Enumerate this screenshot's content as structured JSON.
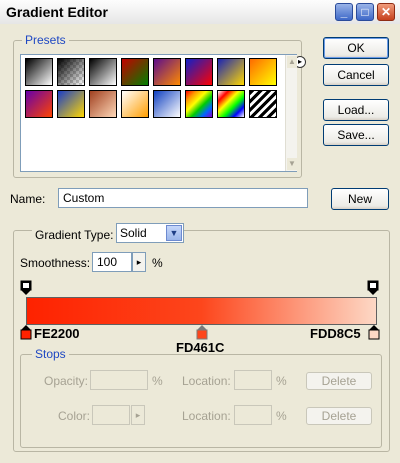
{
  "window": {
    "title": "Gradient Editor",
    "min_glyph": "_",
    "max_glyph": "□",
    "close_glyph": "✕"
  },
  "buttons": {
    "ok": "OK",
    "cancel": "Cancel",
    "load": "Load...",
    "save": "Save...",
    "new": "New",
    "delete": "Delete"
  },
  "presets": {
    "legend": "Presets",
    "swatches": [
      [
        "#000000",
        "#ffffff"
      ],
      [
        "checker",
        "checker"
      ],
      [
        "#000000",
        "#ffffff"
      ],
      [
        "#c40000",
        "#008000"
      ],
      [
        "#5c0d8c",
        "#ff8a00"
      ],
      [
        "#1020c8",
        "#ff0000"
      ],
      [
        "#1a24b4",
        "#ffd800"
      ],
      [
        "#ff6a00",
        "#ffff00"
      ],
      [
        "#6600aa",
        "#ff4400"
      ],
      [
        "#1a3dc8",
        "#ffd800"
      ],
      [
        "#a04020",
        "#ffd8b8"
      ],
      [
        "#ffffff",
        "#ff9e00"
      ],
      [
        "#1040c0",
        "#ffffff"
      ],
      [
        "rainbow",
        "rainbow"
      ],
      [
        "rainbow2",
        "rainbow2"
      ],
      [
        "stripes",
        "stripes"
      ]
    ]
  },
  "name": {
    "label": "Name:",
    "value": "Custom"
  },
  "gradient_type": {
    "legend": "Gradient Type:",
    "value": "Solid"
  },
  "smoothness": {
    "label": "Smoothness:",
    "value": "100",
    "unit": "%"
  },
  "gradient": {
    "colors": [
      "#FE2200",
      "#FD461C",
      "#FDD8C5"
    ],
    "stop_labels": [
      "FE2200",
      "FD461C",
      "FDD8C5"
    ]
  },
  "stops": {
    "legend": "Stops",
    "opacity_label": "Opacity:",
    "opacity_unit": "%",
    "location_label": "Location:",
    "location_unit": "%",
    "color_label": "Color:"
  }
}
